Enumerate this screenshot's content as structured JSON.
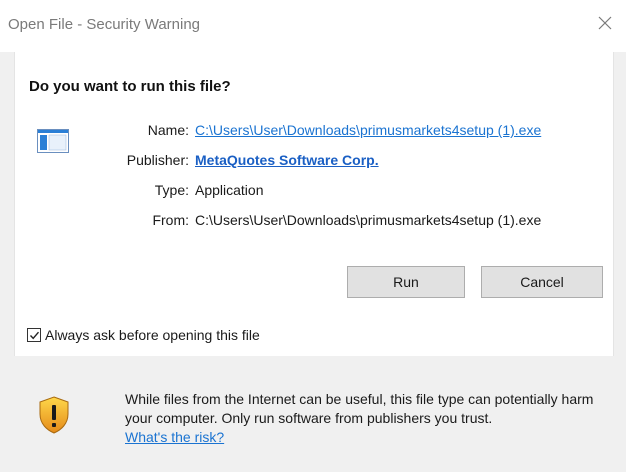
{
  "window": {
    "title": "Open File - Security Warning"
  },
  "dialog": {
    "question": "Do you want to run this file?",
    "details": {
      "name_label": "Name:",
      "name_value": "C:\\Users\\User\\Downloads\\primusmarkets4setup (1).exe",
      "publisher_label": "Publisher:",
      "publisher_value": "MetaQuotes Software Corp.",
      "type_label": "Type:",
      "type_value": "Application",
      "from_label": "From:",
      "from_value": "C:\\Users\\User\\Downloads\\primusmarkets4setup (1).exe"
    },
    "buttons": {
      "run_label": "Run",
      "cancel_label": "Cancel"
    },
    "checkbox": {
      "label": "Always ask before opening this file",
      "checked": true
    }
  },
  "warning": {
    "text": "While files from the Internet can be useful, this file type can potentially harm your computer. Only run software from publishers you trust.",
    "link_label": "What's the risk?"
  },
  "icons": {
    "close": "close-icon",
    "file": "application-file-icon",
    "checkmark": "checkmark-icon",
    "shield": "shield-warning-icon"
  },
  "colors": {
    "link": "#1a73d1",
    "shield_yellow": "#f5c518",
    "shield_orange": "#e48a1a",
    "file_icon_blue": "#2a7fd6"
  }
}
